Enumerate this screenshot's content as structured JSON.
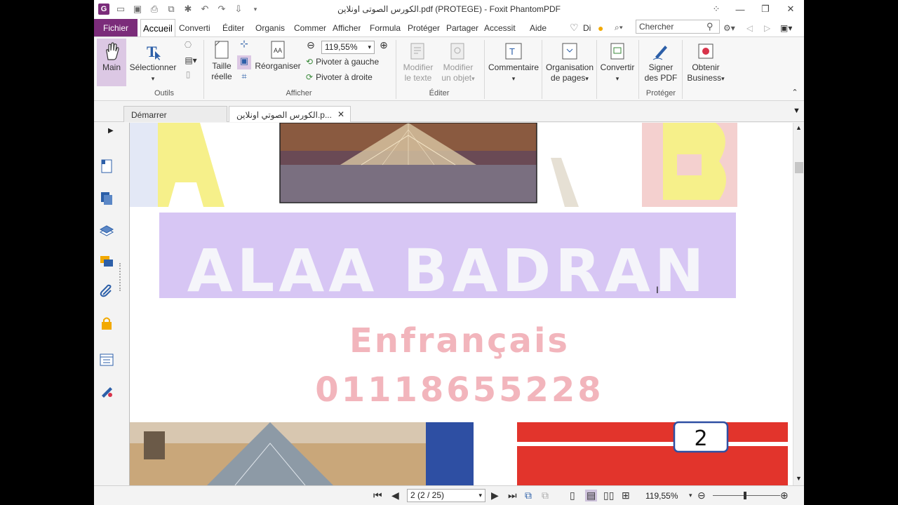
{
  "titlebar": {
    "title": "الكورس الصوتى اونلاين.pdf (PROTEGE) - Foxit PhantomPDF",
    "app_logo": "G"
  },
  "menu": {
    "file": "Fichier",
    "tabs": [
      "Accueil",
      "Converti",
      "Éditer",
      "Organis",
      "Commer",
      "Afficher",
      "Formula",
      "Protéger",
      "Partager",
      "Accessit",
      "Aide"
    ],
    "tell_me": "Di",
    "search_placeholder": "Chercher"
  },
  "ribbon": {
    "main_label": "Main",
    "select_label": "Sélectionner",
    "outils_group": "Outils",
    "actual_size_line1": "Taille",
    "actual_size_line2": "réelle",
    "reorganize": "Réorganiser",
    "zoom_value": "119,55%",
    "rotate_left": "Pivoter à gauche",
    "rotate_right": "Pivoter à droite",
    "afficher_group": "Afficher",
    "edit_text_line1": "Modifier",
    "edit_text_line2": "le texte",
    "edit_object_line1": "Modifier",
    "edit_object_line2": "un objet",
    "editer_group": "Éditer",
    "comment": "Commentaire",
    "page_org_line1": "Organisation",
    "page_org_line2": "de pages",
    "convert": "Convertir",
    "sign_line1": "Signer",
    "sign_line2": "des PDF",
    "proteger_group": "Protéger",
    "business_line1": "Obtenir",
    "business_line2": "Business"
  },
  "doctabs": {
    "start": "Démarrer",
    "current": "الكورس الصوتي اونلاين.p..."
  },
  "document": {
    "letter_a": "A",
    "letter_b": "B",
    "name": "ALAA BADRAN",
    "subtitle": "Enfrançais",
    "phone": "01118655228",
    "page_badge": "2"
  },
  "statusbar": {
    "page_value": "2 (2 / 25)",
    "zoom_value": "119,55%"
  },
  "colors": {
    "brand": "#7b2c7a",
    "banner_purple": "#c9b3f0",
    "flag_blue": "#2e4fa3",
    "flag_red": "#e2342c"
  }
}
